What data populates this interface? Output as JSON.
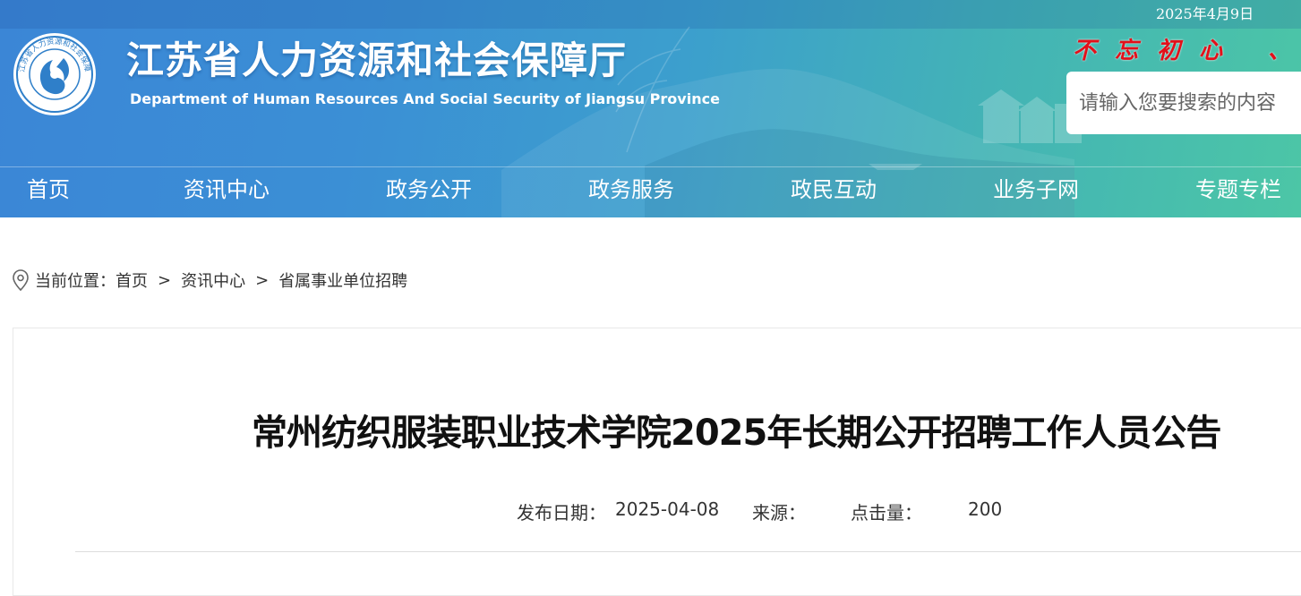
{
  "header": {
    "date": "2025年4月9日",
    "site_title": "江苏省人力资源和社会保障厅",
    "site_subtitle": "Department of Human Resources And Social Security of Jiangsu Province",
    "logo_ring_text": "江苏省人力资源和社会保障厅",
    "slogan": "不忘初心 、",
    "slogan_color": "#e3101a",
    "search_placeholder": "请输入您要搜索的内容"
  },
  "nav": {
    "items": [
      {
        "label": "首页"
      },
      {
        "label": "资讯中心"
      },
      {
        "label": "政务公开"
      },
      {
        "label": "政务服务"
      },
      {
        "label": "政民互动"
      },
      {
        "label": "业务子网"
      },
      {
        "label": "专题专栏"
      }
    ]
  },
  "breadcrumb": {
    "icon": "location-pin-icon",
    "prefix": "当前位置：",
    "items": [
      "首页",
      "资讯中心",
      "省属事业单位招聘"
    ],
    "separator": ">"
  },
  "article": {
    "title": "常州纺织服装职业技术学院2025年长期公开招聘工作人员公告",
    "publish_label": "发布日期：",
    "publish_date": "2025-04-08",
    "source_label": "来源：",
    "source_value": "",
    "hits_label": "点击量：",
    "hits_value": "200"
  },
  "colors": {
    "header_gradient_start": "#3b86d6",
    "header_gradient_end": "#4cc6a6",
    "text_dark": "#333333"
  }
}
